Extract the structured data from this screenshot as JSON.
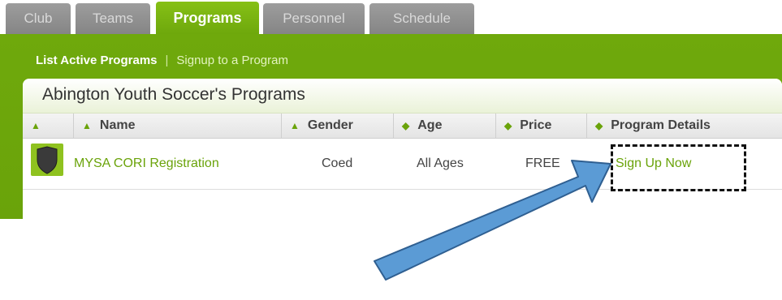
{
  "tabs": [
    {
      "label": "Club"
    },
    {
      "label": "Teams"
    },
    {
      "label": "Programs"
    },
    {
      "label": "Personnel"
    },
    {
      "label": "Schedule"
    }
  ],
  "active_tab": "Programs",
  "subnav": {
    "active": "List Active Programs",
    "separator": "|",
    "link": "Signup to a Program"
  },
  "panel": {
    "title": "Abington Youth Soccer's Programs"
  },
  "table": {
    "columns": [
      "Name",
      "Gender",
      "Age",
      "Price",
      "Program Details"
    ],
    "rows": [
      {
        "icon": "shield-icon",
        "name": "MYSA CORI Registration",
        "gender": "Coed",
        "age": "All Ages",
        "price": "FREE",
        "details": "Sign Up Now"
      }
    ]
  },
  "colors": {
    "accent": "#6aa30a",
    "tab_inactive": "#8f8f8f",
    "annotation_arrow": "#5b9bd5"
  }
}
